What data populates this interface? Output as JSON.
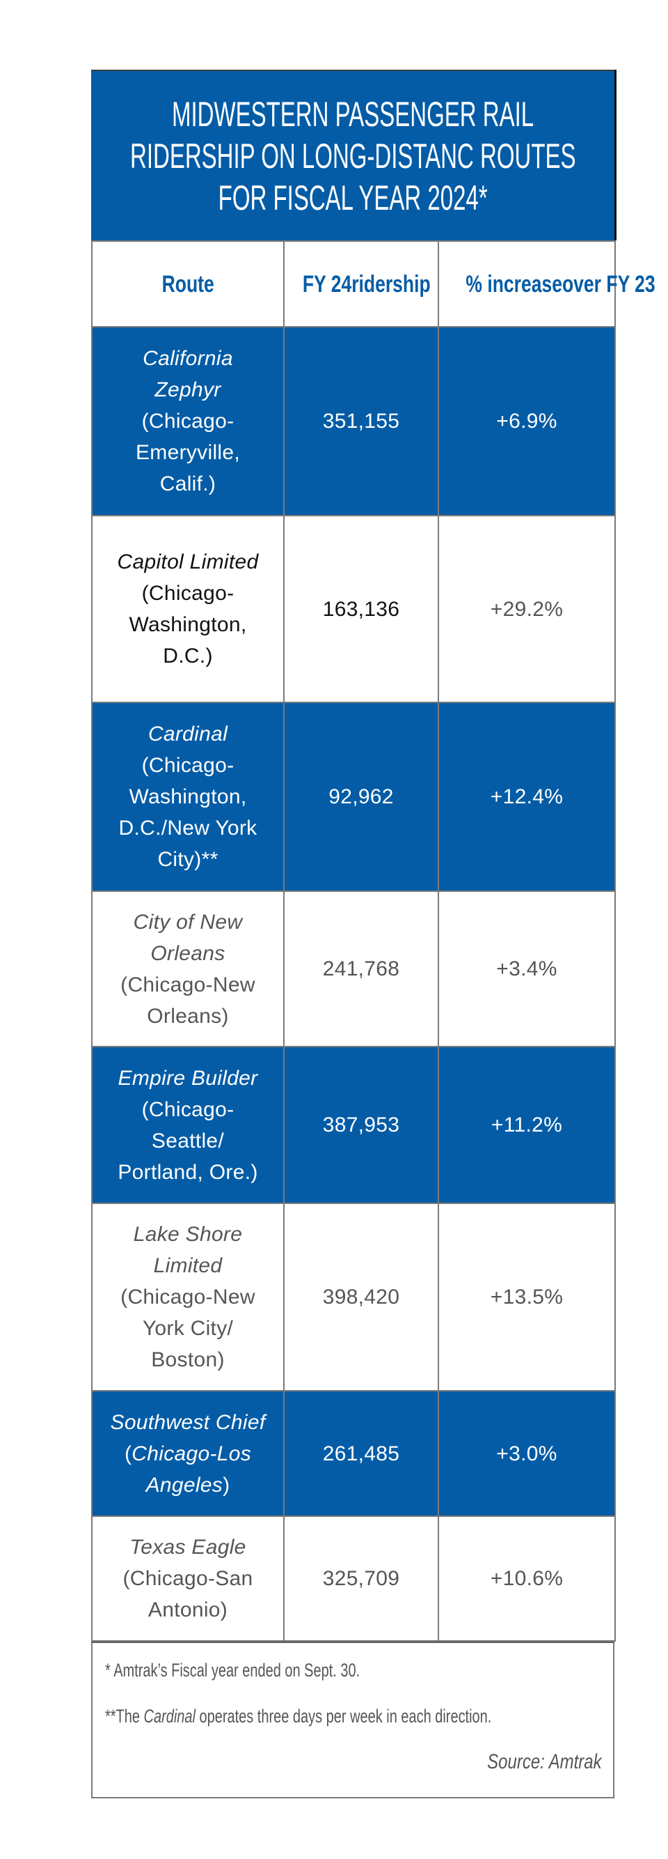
{
  "title": {
    "lines": [
      "MIDWESTERN PASSENGER RAIL",
      "RIDERSHIP ON LONG-DISTANC ROUTES",
      "FOR FISCAL YEAR 2024*"
    ]
  },
  "colors": {
    "brand_blue": "#055ca6",
    "muted_text": "#555555",
    "dark_text": "#111111"
  },
  "table": {
    "headers": [
      {
        "lines": [
          "Route"
        ]
      },
      {
        "lines": [
          "FY 24",
          "ridership"
        ]
      },
      {
        "lines": [
          "% increase",
          "over FY 23"
        ]
      }
    ],
    "rows": [
      {
        "name_lines": [
          "California",
          "Zephyr"
        ],
        "detail_lines": [
          "(Chicago-",
          "Emeryville,",
          "Calif.)"
        ],
        "ridership": "351,155",
        "increase": "+6.9%",
        "style": "blue"
      },
      {
        "name_lines": [
          "Capitol Limited"
        ],
        "detail_lines": [
          "(Chicago-",
          "Washington,",
          "D.C.)"
        ],
        "ridership": "163,136",
        "increase": "+29.2%",
        "style": "white"
      },
      {
        "name_lines": [
          "Cardinal"
        ],
        "detail_lines": [
          "(Chicago-",
          "Washington,",
          "D.C./New York",
          "City)**"
        ],
        "ridership": "92,962",
        "increase": "+12.4%",
        "style": "blue"
      },
      {
        "name_lines": [
          "City of New",
          "Orleans"
        ],
        "detail_lines": [
          "(Chicago-New",
          "Orleans)"
        ],
        "ridership": "241,768",
        "increase": "+3.4%",
        "style": "white"
      },
      {
        "name_lines": [
          "Empire Builder"
        ],
        "detail_lines": [
          "(Chicago-",
          "Seattle/",
          "Portland, Ore.)"
        ],
        "ridership": "387,953",
        "increase": "+11.2%",
        "style": "blue"
      },
      {
        "name_lines": [
          "Lake Shore",
          "Limited"
        ],
        "detail_lines": [
          "(Chicago-New",
          "York City/",
          "Boston)"
        ],
        "ridership": "398,420",
        "increase": "+13.5%",
        "style": "white"
      },
      {
        "name_lines": [
          "Southwest Chief"
        ],
        "detail_lines": [
          "(Chicago-Los",
          "Angeles)"
        ],
        "ridership": "261,485",
        "increase": "+3.0%",
        "style": "blue"
      },
      {
        "name_lines": [
          "Texas Eagle"
        ],
        "detail_lines": [
          "(Chicago-San",
          "Antonio)"
        ],
        "ridership": "325,709",
        "increase": "+10.6%",
        "style": "white"
      }
    ]
  },
  "footnotes": {
    "note1": "* Amtrak’s Fiscal year ended on Sept. 30.",
    "note2_prefix": "**The ",
    "note2_italic": "Cardinal",
    "note2_suffix": " operates three days per week in each direction.",
    "source": "Source: Amtrak"
  }
}
